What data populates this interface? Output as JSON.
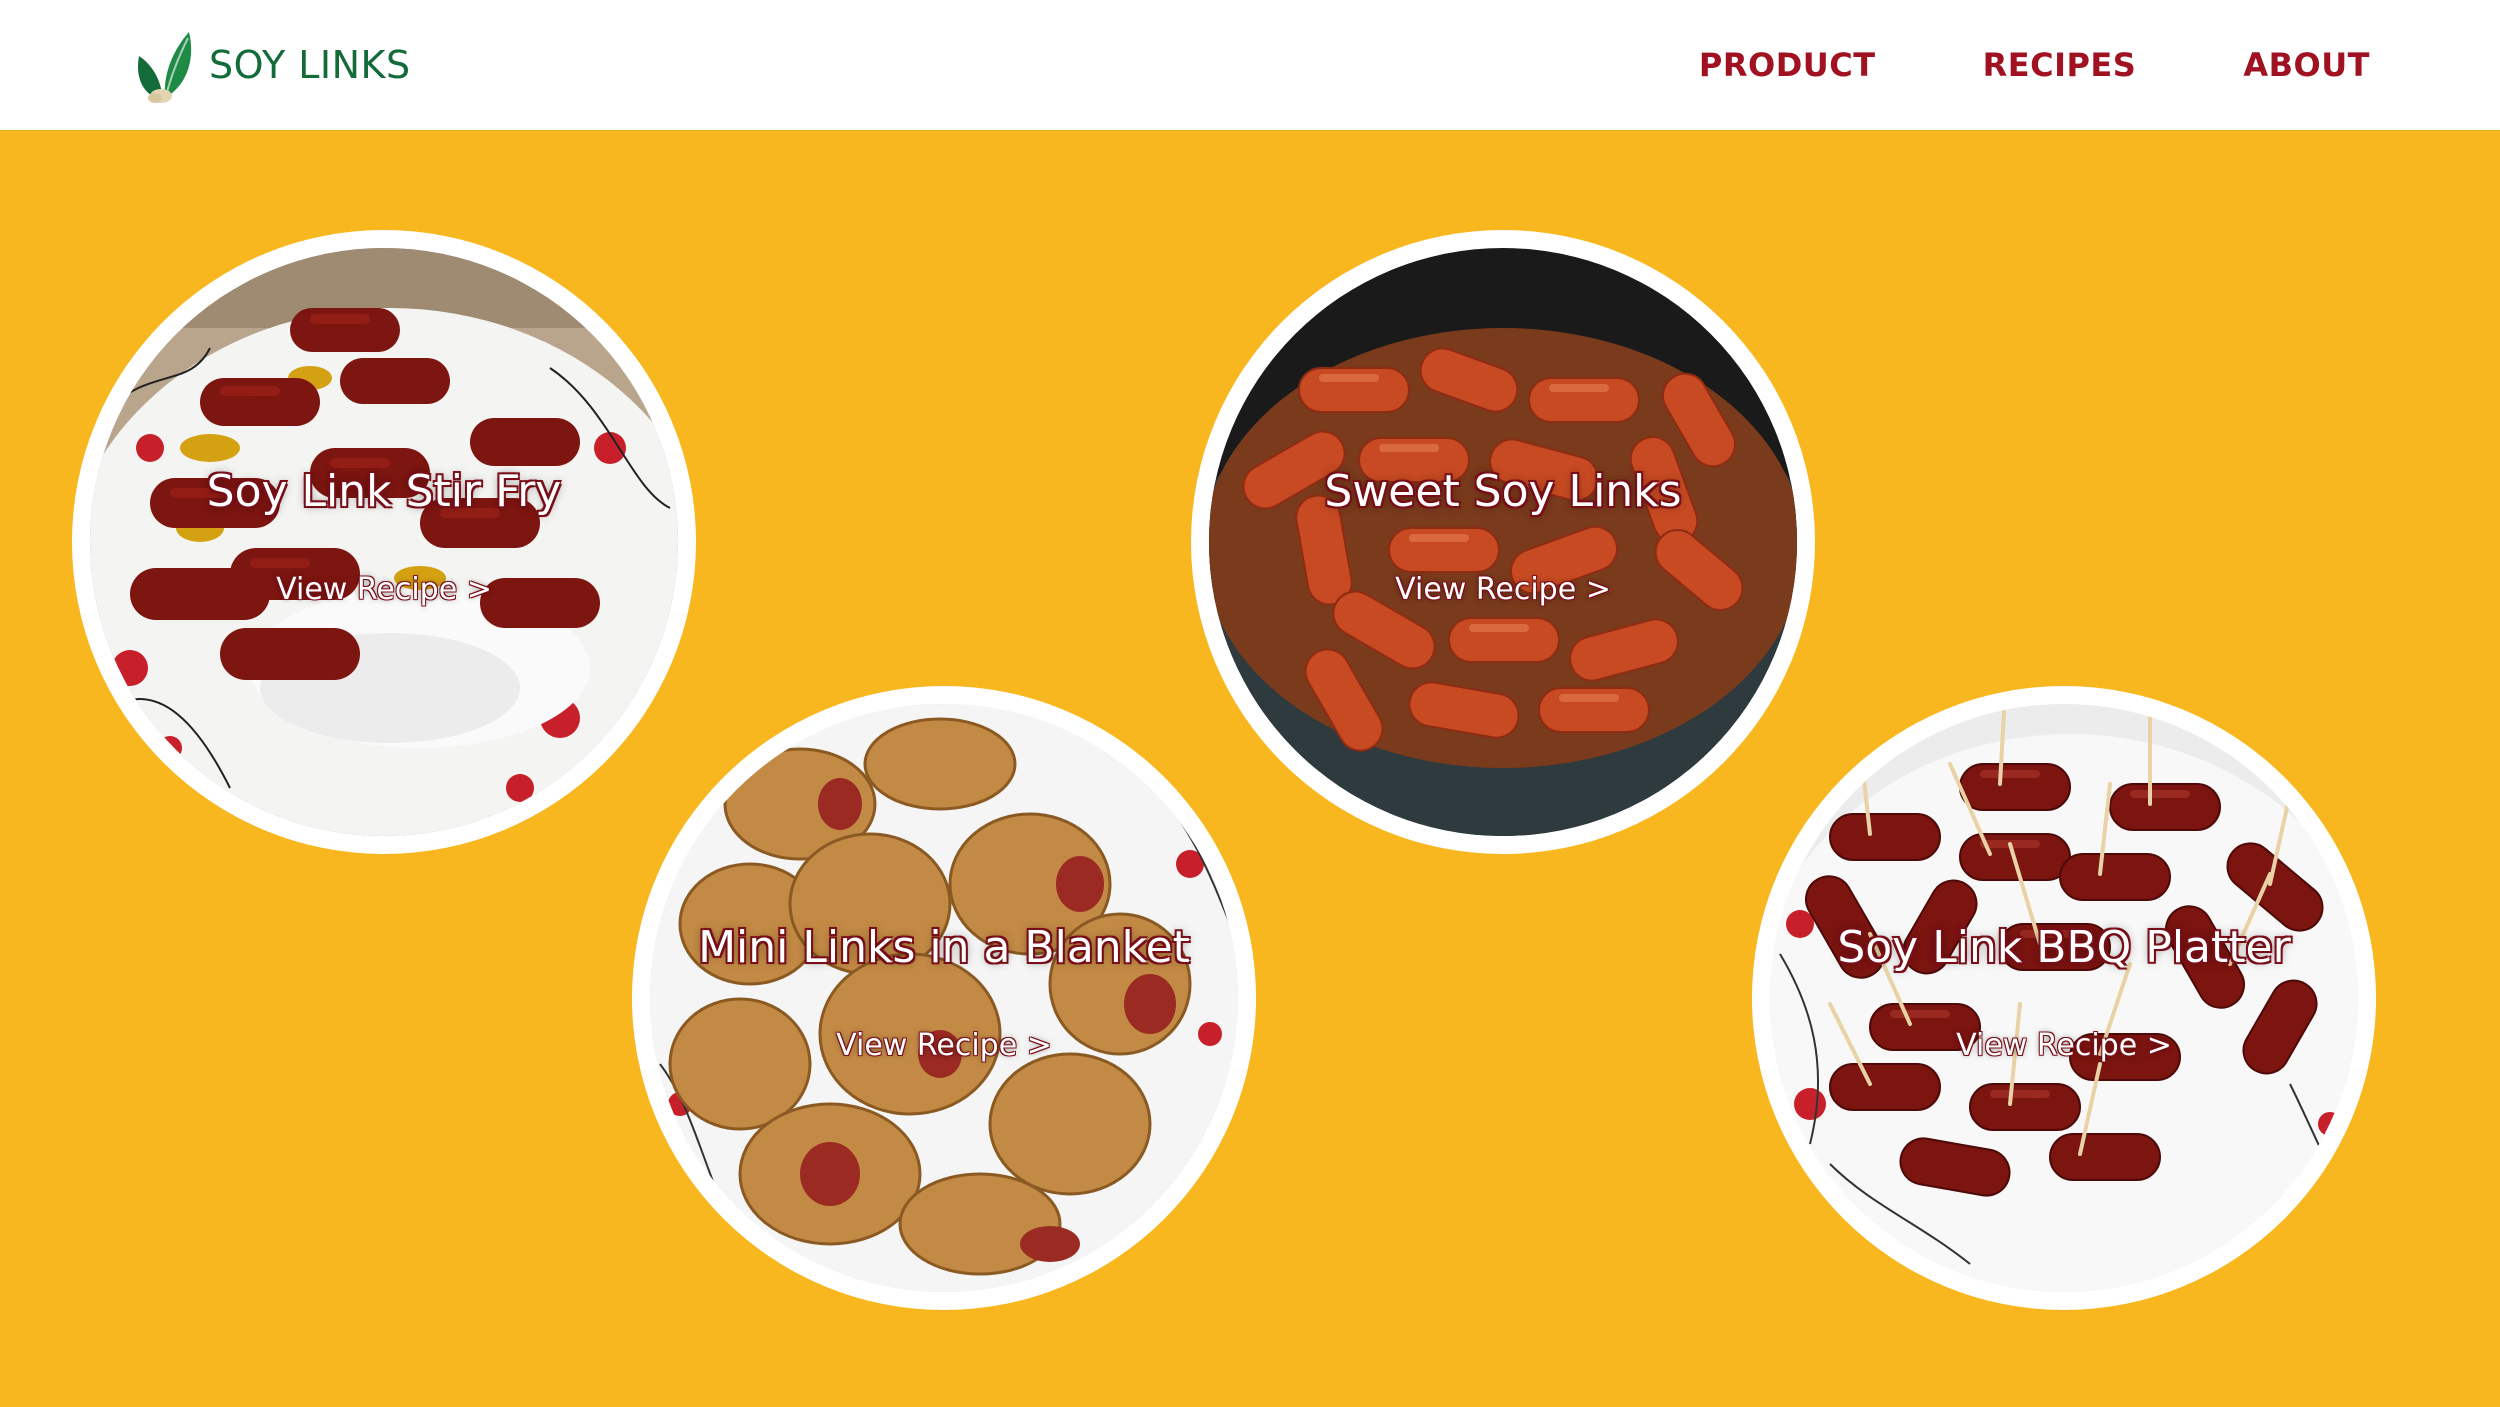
{
  "brand": {
    "name": "SOY LINKS",
    "colors": {
      "brand_green": "#136b3a",
      "nav_red": "#a01222",
      "background_yellow": "#f9b71f",
      "card_border": "#ffffff"
    }
  },
  "nav": {
    "items": [
      {
        "label": "PRODUCT"
      },
      {
        "label": "RECIPES"
      },
      {
        "label": "ABOUT"
      }
    ]
  },
  "recipes": [
    {
      "title": "Soy Link Stir Fry",
      "link_label": "View Recipe >",
      "photo_icon": "stir-fry-photo"
    },
    {
      "title": "Mini Links in a Blanket",
      "link_label": "View Recipe >",
      "photo_icon": "links-in-blanket-photo"
    },
    {
      "title": "Sweet Soy Links",
      "link_label": "View Recipe >",
      "photo_icon": "sweet-soy-links-photo"
    },
    {
      "title": "Soy Link BBQ Platter",
      "link_label": "View Recipe >",
      "photo_icon": "bbq-platter-photo"
    }
  ]
}
